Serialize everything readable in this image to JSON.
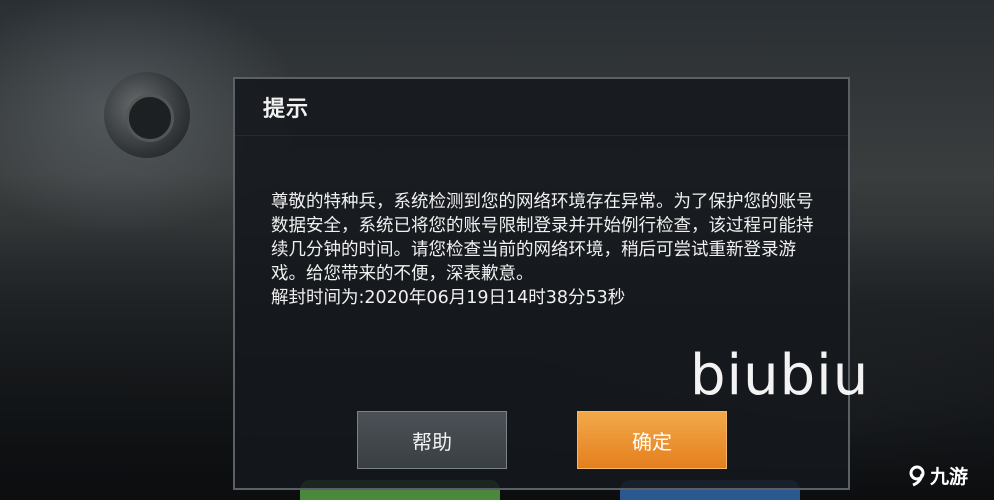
{
  "dialog": {
    "title": "提示",
    "message": "尊敬的特种兵，系统检测到您的网络环境存在异常。为了保护您的账号数据安全，系统已将您的账号限制登录并开始例行检查，该过程可能持续几分钟的时间。请您检查当前的网络环境，稍后可尝试重新登录游戏。给您带来的不便，深表歉意。",
    "unlock_time": "解封时间为:2020年06月19日14时38分53秒",
    "help_button": "帮助",
    "confirm_button": "确定"
  },
  "watermark": {
    "text": "biubiu"
  },
  "logo": {
    "text": "九游",
    "icon": "9-logo-icon"
  },
  "colors": {
    "confirm_button": "#e8892a",
    "help_button": "#43494e",
    "dialog_bg": "#14181c",
    "dialog_border": "#5a6066"
  }
}
